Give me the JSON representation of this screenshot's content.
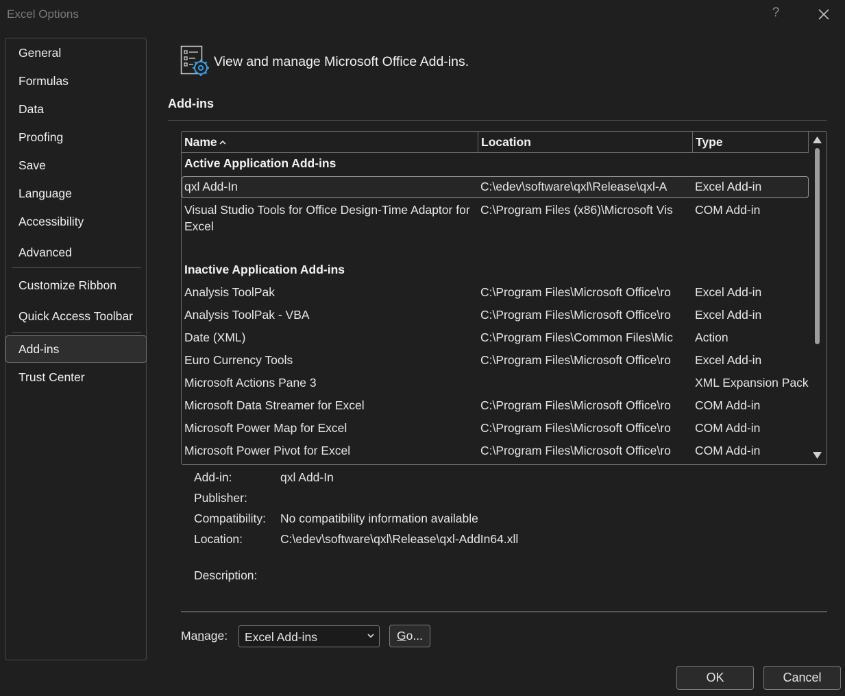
{
  "window": {
    "title": "Excel Options",
    "help_label": "?"
  },
  "sidebar": {
    "items": [
      {
        "label": "General"
      },
      {
        "label": "Formulas"
      },
      {
        "label": "Data"
      },
      {
        "label": "Proofing"
      },
      {
        "label": "Save"
      },
      {
        "label": "Language"
      },
      {
        "label": "Accessibility"
      },
      {
        "label": "Advanced"
      },
      {
        "label": "Customize Ribbon"
      },
      {
        "label": "Quick Access Toolbar"
      },
      {
        "label": "Add-ins",
        "selected": true
      },
      {
        "label": "Trust Center"
      }
    ]
  },
  "main": {
    "header_text": "View and manage Microsoft Office Add-ins.",
    "section_title": "Add-ins",
    "columns": {
      "name": "Name",
      "location": "Location",
      "type": "Type"
    },
    "groups": {
      "active": "Active Application Add-ins",
      "inactive": "Inactive Application Add-ins"
    },
    "active_rows": [
      {
        "name": "qxl Add-In",
        "location": "C:\\edev\\software\\qxl\\Release\\qxl-A",
        "type": "Excel Add-in"
      },
      {
        "name": "Visual Studio Tools for Office Design-Time Adaptor for Excel",
        "location": "C:\\Program Files (x86)\\Microsoft Vis",
        "type": "COM Add-in"
      }
    ],
    "inactive_rows": [
      {
        "name": "Analysis ToolPak",
        "location": "C:\\Program Files\\Microsoft Office\\ro",
        "type": "Excel Add-in"
      },
      {
        "name": "Analysis ToolPak - VBA",
        "location": "C:\\Program Files\\Microsoft Office\\ro",
        "type": "Excel Add-in"
      },
      {
        "name": "Date (XML)",
        "location": "C:\\Program Files\\Common Files\\Mic",
        "type": "Action"
      },
      {
        "name": "Euro Currency Tools",
        "location": "C:\\Program Files\\Microsoft Office\\ro",
        "type": "Excel Add-in"
      },
      {
        "name": "Microsoft Actions Pane 3",
        "location": "",
        "type": "XML Expansion Pack"
      },
      {
        "name": "Microsoft Data Streamer for Excel",
        "location": "C:\\Program Files\\Microsoft Office\\ro",
        "type": "COM Add-in"
      },
      {
        "name": "Microsoft Power Map for Excel",
        "location": "C:\\Program Files\\Microsoft Office\\ro",
        "type": "COM Add-in"
      },
      {
        "name": "Microsoft Power Pivot for Excel",
        "location": "C:\\Program Files\\Microsoft Office\\ro",
        "type": "COM Add-in"
      }
    ]
  },
  "details": {
    "addin_label": "Add-in:",
    "addin_value": "qxl Add-In",
    "publisher_label": "Publisher:",
    "publisher_value": "",
    "compat_label": "Compatibility:",
    "compat_value": "No compatibility information available",
    "location_label": "Location:",
    "location_value": "C:\\edev\\software\\qxl\\Release\\qxl-AddIn64.xll",
    "description_label": "Description:",
    "description_value": ""
  },
  "footer": {
    "manage_label_pre": "Ma",
    "manage_label_ul": "n",
    "manage_label_post": "age:",
    "manage_value": "Excel Add-ins",
    "go_ul": "G",
    "go_post": "o...",
    "ok_label": "OK",
    "cancel_label": "Cancel"
  },
  "colors": {
    "background": "#1f1f1f",
    "accent_icon": "#3aa0e8"
  }
}
